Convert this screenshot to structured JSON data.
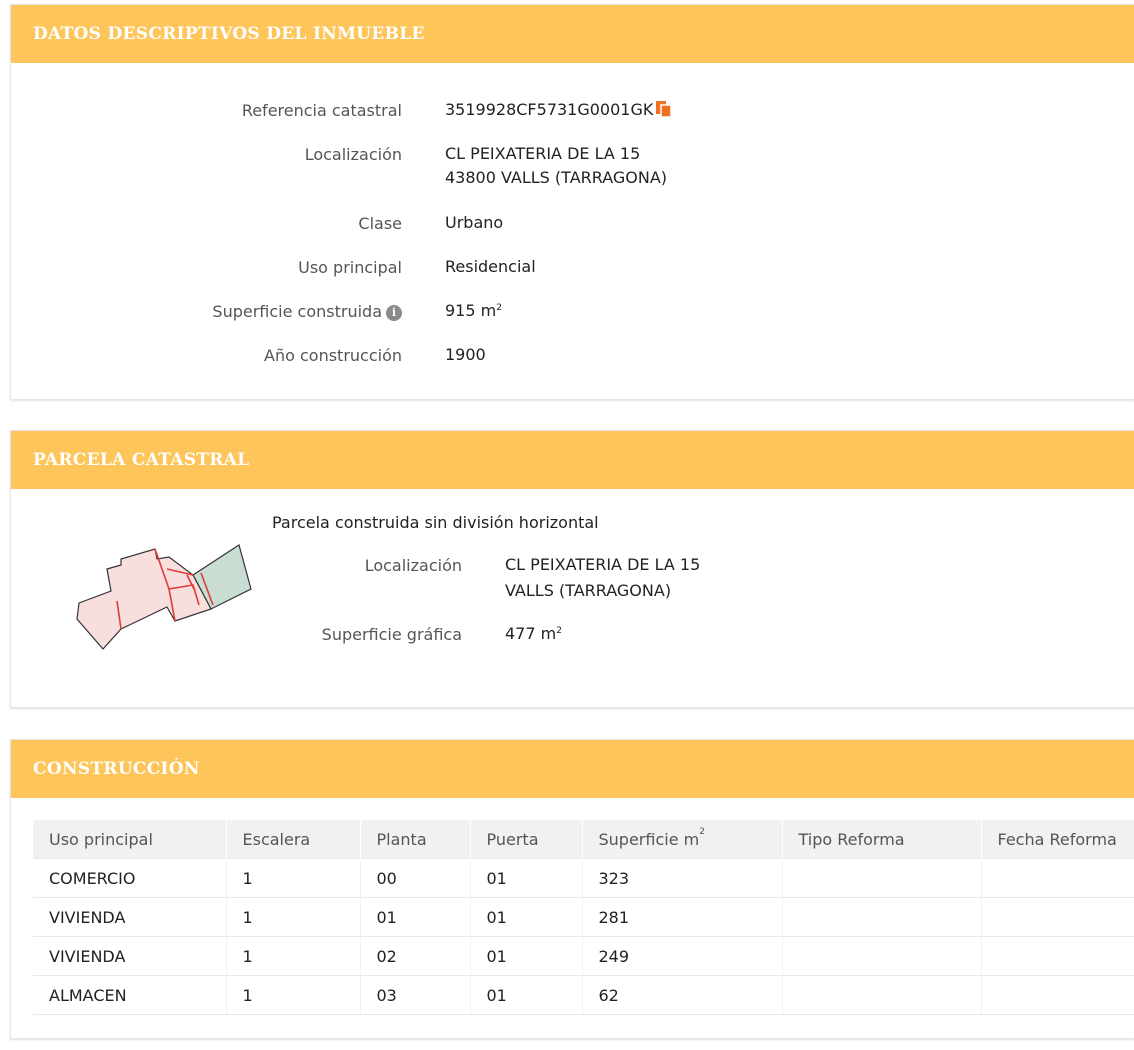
{
  "datos": {
    "title": "DATOS DESCRIPTIVOS DEL INMUEBLE",
    "rows": [
      {
        "label": "Referencia catastral",
        "value": "3519928CF5731G0001GK"
      },
      {
        "label": "Localización",
        "value": "CL PEIXATERIA DE LA 15",
        "value2": "43800 VALLS (TARRAGONA)"
      },
      {
        "label": "Clase",
        "value": "Urbano"
      },
      {
        "label": "Uso principal",
        "value": "Residencial"
      },
      {
        "label": "Superficie construida",
        "value": "915 m",
        "unit_sup": "2"
      },
      {
        "label": "Año construcción",
        "value": "1900"
      }
    ],
    "copy_icon": "copy-icon",
    "info_icon": "info-icon",
    "info_glyph": "i"
  },
  "parcela": {
    "title": "PARCELA CATASTRAL",
    "subtitle": "Parcela construida sin división horizontal",
    "loc_label": "Localización",
    "loc_value": "CL PEIXATERIA DE LA 15",
    "loc_value2": "VALLS (TARRAGONA)",
    "sup_label": "Superficie gráfica",
    "sup_value": "477 m",
    "sup_sup": "2",
    "map_colors": {
      "parcel_fill": "#f9dede",
      "neighbor_fill": "#c9ddd2",
      "division": "#e03a3a",
      "outline": "#333333"
    }
  },
  "construccion": {
    "title": "CONSTRUCCIÓN",
    "headers": [
      "Uso principal",
      "Escalera",
      "Planta",
      "Puerta",
      "Superficie m",
      "Tipo Reforma",
      "Fecha Reforma"
    ],
    "superficie_sup": "2",
    "rows": [
      [
        "COMERCIO",
        "1",
        "00",
        "01",
        "323",
        "",
        ""
      ],
      [
        "VIVIENDA",
        "1",
        "01",
        "01",
        "281",
        "",
        ""
      ],
      [
        "VIVIENDA",
        "1",
        "02",
        "01",
        "249",
        "",
        ""
      ],
      [
        "ALMACEN",
        "1",
        "03",
        "01",
        "62",
        "",
        ""
      ]
    ]
  },
  "colors": {
    "header_bg": "#fdc55a",
    "copy_icon": "#f07020"
  }
}
